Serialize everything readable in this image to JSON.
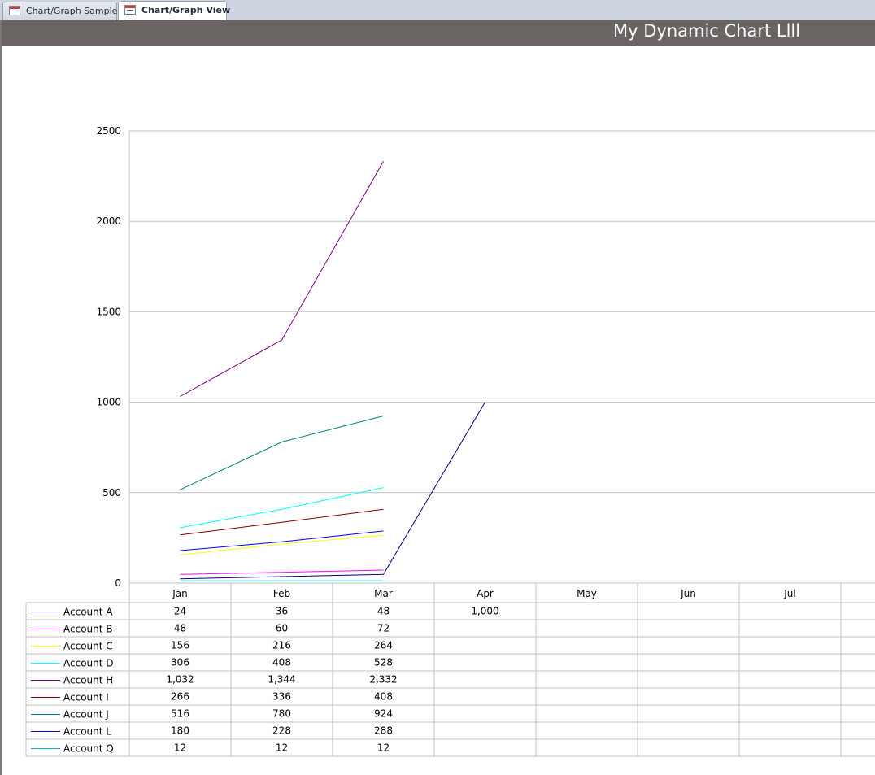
{
  "tabs": [
    {
      "label": "Chart/Graph Sample",
      "active": false
    },
    {
      "label": "Chart/Graph View",
      "active": true
    }
  ],
  "form": {
    "title": "My Dynamic Chart Llll"
  },
  "chart_data": {
    "type": "line",
    "categories": [
      "Jan",
      "Feb",
      "Mar",
      "Apr",
      "May",
      "Jun",
      "Jul"
    ],
    "ylim": [
      0,
      2500
    ],
    "yticks": [
      "0",
      "500",
      "1000",
      "1500",
      "2000",
      "2500"
    ],
    "grid": true,
    "legend": "data-table-left",
    "series": [
      {
        "name": "Account A",
        "color": "#000080",
        "values": [
          24,
          36,
          48,
          1000,
          null,
          null,
          null
        ],
        "labels": [
          "24",
          "36",
          "48",
          "1,000",
          "",
          "",
          ""
        ]
      },
      {
        "name": "Account B",
        "color": "#ff00ff",
        "values": [
          48,
          60,
          72,
          null,
          null,
          null,
          null
        ],
        "labels": [
          "48",
          "60",
          "72",
          "",
          "",
          "",
          ""
        ]
      },
      {
        "name": "Account C",
        "color": "#ffff00",
        "values": [
          156,
          216,
          264,
          null,
          null,
          null,
          null
        ],
        "labels": [
          "156",
          "216",
          "264",
          "",
          "",
          "",
          ""
        ]
      },
      {
        "name": "Account D",
        "color": "#00ffff",
        "values": [
          306,
          408,
          528,
          null,
          null,
          null,
          null
        ],
        "labels": [
          "306",
          "408",
          "528",
          "",
          "",
          "",
          ""
        ]
      },
      {
        "name": "Account H",
        "color": "#800080",
        "values": [
          1032,
          1344,
          2332,
          null,
          null,
          null,
          null
        ],
        "labels": [
          "1,032",
          "1,344",
          "2,332",
          "",
          "",
          "",
          ""
        ]
      },
      {
        "name": "Account I",
        "color": "#800000",
        "values": [
          266,
          336,
          408,
          null,
          null,
          null,
          null
        ],
        "labels": [
          "266",
          "336",
          "408",
          "",
          "",
          "",
          ""
        ]
      },
      {
        "name": "Account J",
        "color": "#008080",
        "values": [
          516,
          780,
          924,
          null,
          null,
          null,
          null
        ],
        "labels": [
          "516",
          "780",
          "924",
          "",
          "",
          "",
          ""
        ]
      },
      {
        "name": "Account L",
        "color": "#0000ff",
        "values": [
          180,
          228,
          288,
          null,
          null,
          null,
          null
        ],
        "labels": [
          "180",
          "228",
          "288",
          "",
          "",
          "",
          ""
        ]
      },
      {
        "name": "Account Q",
        "color": "#00b0d0",
        "values": [
          12,
          12,
          12,
          null,
          null,
          null,
          null
        ],
        "labels": [
          "12",
          "12",
          "12",
          "",
          "",
          "",
          ""
        ]
      }
    ]
  }
}
